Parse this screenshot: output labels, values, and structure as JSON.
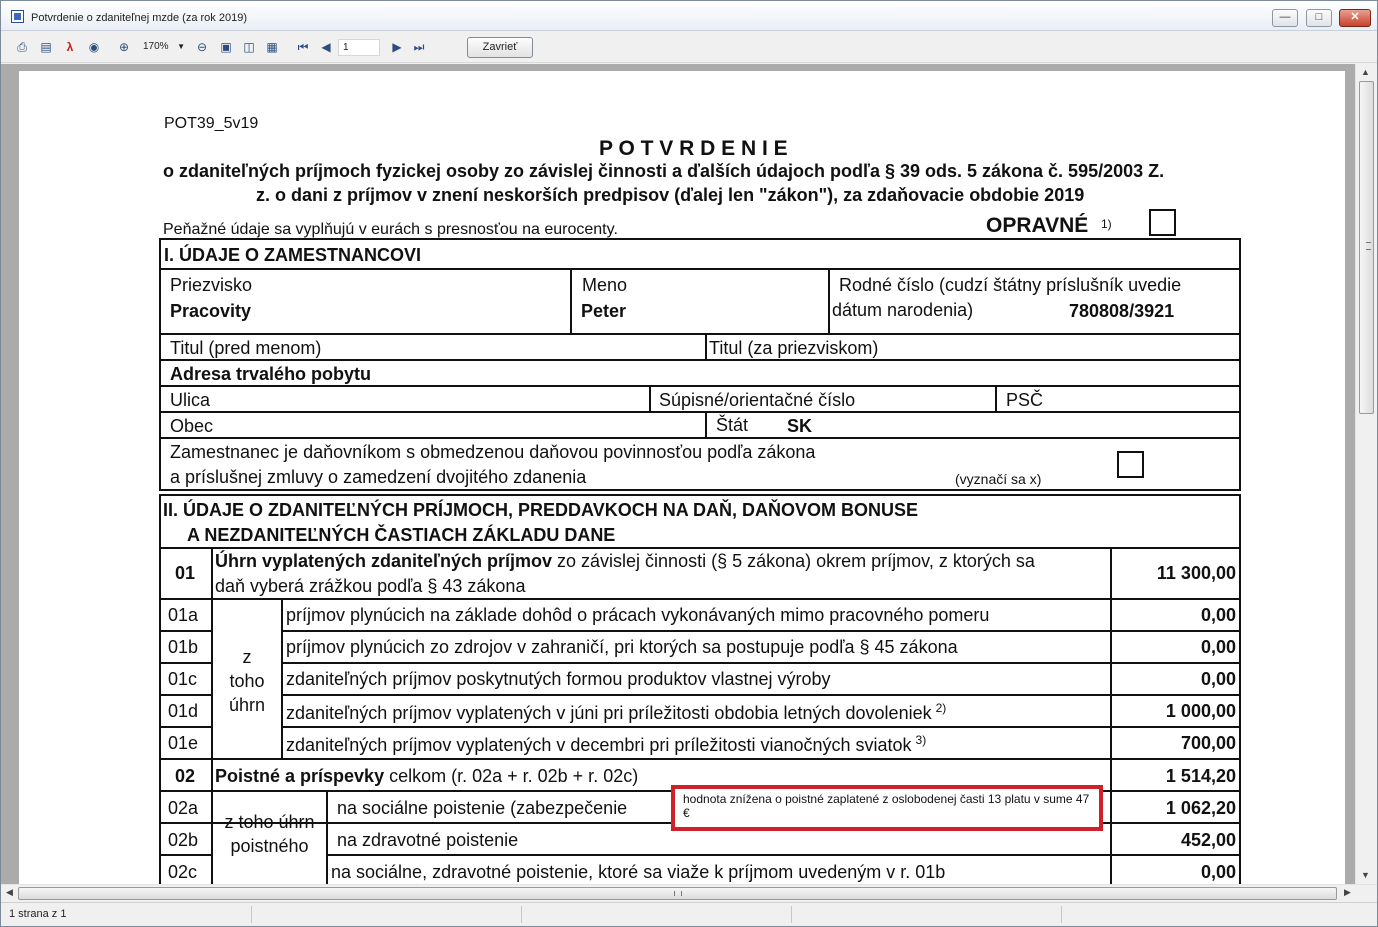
{
  "window": {
    "title": "Potvrdenie o zdaniteľnej mzde (za rok 2019)",
    "minimize_glyph": "—",
    "maximize_glyph": "□",
    "close_glyph": "✕"
  },
  "toolbar": {
    "icons": [
      "print-icon",
      "print-preview-icon",
      "pdf-export-icon",
      "binoculars-find-icon",
      "zoom-in-icon",
      "zoom-out-icon",
      "single-page-icon",
      "two-page-icon",
      "multi-page-icon",
      "first-page-icon",
      "previous-page-icon",
      "next-page-icon",
      "last-page-icon"
    ],
    "zoom_value": "170%",
    "page_value": "1",
    "close_label": "Zavrieť"
  },
  "status": {
    "page_info": "1 strana z 1"
  },
  "doc": {
    "form_code": "POT39_5v19",
    "heading": "P O T V R D E N I E",
    "subheading_line1": "o zdaniteľných príjmoch fyzickej osoby zo závislej činnosti a ďalších údajoch podľa § 39 ods. 5 zákona č. 595/2003 Z.",
    "subheading_line2": "z. o dani z príjmov v znení neskorších predpisov (ďalej len \"zákon\"), za zdaňovacie obdobie 2019",
    "currency_note": "Peňažné údaje sa vyplňujú v eurách s presnosťou na eurocenty.",
    "corrective_label": "OPRAVNÉ",
    "corrective_note": "1)",
    "section1": {
      "title": "I.  ÚDAJE O ZAMESTNANCOVI",
      "surname_label": "Priezvisko",
      "surname_value": "Pracovity",
      "name_label": "Meno",
      "name_value": "Peter",
      "birth_label_1": "Rodné číslo (cudzí štátny príslušník uvedie",
      "birth_label_2": "dátum narodenia)",
      "birth_value": "780808/3921",
      "title_before_label": "Titul (pred menom)",
      "title_after_label": "Titul (za priezviskom)",
      "address_label": "Adresa trvalého pobytu",
      "street_label": "Ulica",
      "number_label": "Súpisné/orientačné číslo",
      "zip_label": "PSČ",
      "city_label": "Obec",
      "country_label": "Štát",
      "country_value": "SK",
      "limited_line1": "Zamestnanec je daňovníkom s obmedzenou daňovou povinnosťou podľa zákona",
      "limited_line2": "a príslušnej zmluvy o zamedzení dvojitého zdanenia",
      "limited_hint": "(vyznačí sa x)"
    },
    "section2": {
      "title_line1": "II. ÚDAJE O ZDANITEĽNÝCH PRÍJMOCH, PREDDAVKOCH NA DAŇ, DAŇOVOM BONUSE",
      "title_line2": "A NEZDANITEĽNÝCH ČASTIACH ZÁKLADU DANE",
      "row01_code": "01",
      "row01_bold": "Úhrn vyplatených zdaniteľných príjmov",
      "row01_rest": " zo závislej činnosti (§ 5 zákona) okrem príjmov, z ktorých sa",
      "row01_line2": "daň vyberá zrážkou podľa § 43 zákona",
      "row01_value": "11 300,00",
      "group1_line1": "z",
      "group1_line2": "toho",
      "group1_line3": "úhrn",
      "rows_01": [
        {
          "code": "01a",
          "text": "príjmov plynúcich na základe dohôd o prácach vykonávaných mimo pracovného pomeru",
          "sup": "",
          "value": "0,00"
        },
        {
          "code": "01b",
          "text": "príjmov plynúcich zo zdrojov v zahraničí, pri ktorých sa postupuje podľa § 45 zákona",
          "sup": "",
          "value": "0,00"
        },
        {
          "code": "01c",
          "text": "zdaniteľných príjmov poskytnutých formou produktov vlastnej výroby",
          "sup": "",
          "value": "0,00"
        },
        {
          "code": "01d",
          "text": "zdaniteľných príjmov vyplatených v júni pri príležitosti obdobia letných dovoleniek",
          "sup": "2)",
          "value": "1 000,00"
        },
        {
          "code": "01e",
          "text": "zdaniteľných príjmov vyplatených v decembri pri príležitosti vianočných sviatok",
          "sup": "3)",
          "value": "700,00"
        }
      ],
      "row02_code": "02",
      "row02_bold": "Poistné a príspevky",
      "row02_rest": " celkom (r. 02a + r. 02b + r. 02c)",
      "row02_value": "1 514,20",
      "group2_line1": "z toho úhrn",
      "group2_line2": "poistného",
      "row02a_code": "02a",
      "row02a_text": "na sociálne poistenie (zabezpečenie",
      "row02a_value": "1 062,20",
      "row02b_code": "02b",
      "row02b_text": "na zdravotné poistenie",
      "row02b_value": "452,00",
      "row02c_code": "02c",
      "row02c_text": "na sociálne, zdravotné poistenie, ktoré sa viaže k príjmom uvedeným v r. 01b",
      "row02c_value": "0,00",
      "note": "hodnota znížena o poistné zaplatené z oslobodenej časti 13 platu v sume 47 €"
    }
  }
}
